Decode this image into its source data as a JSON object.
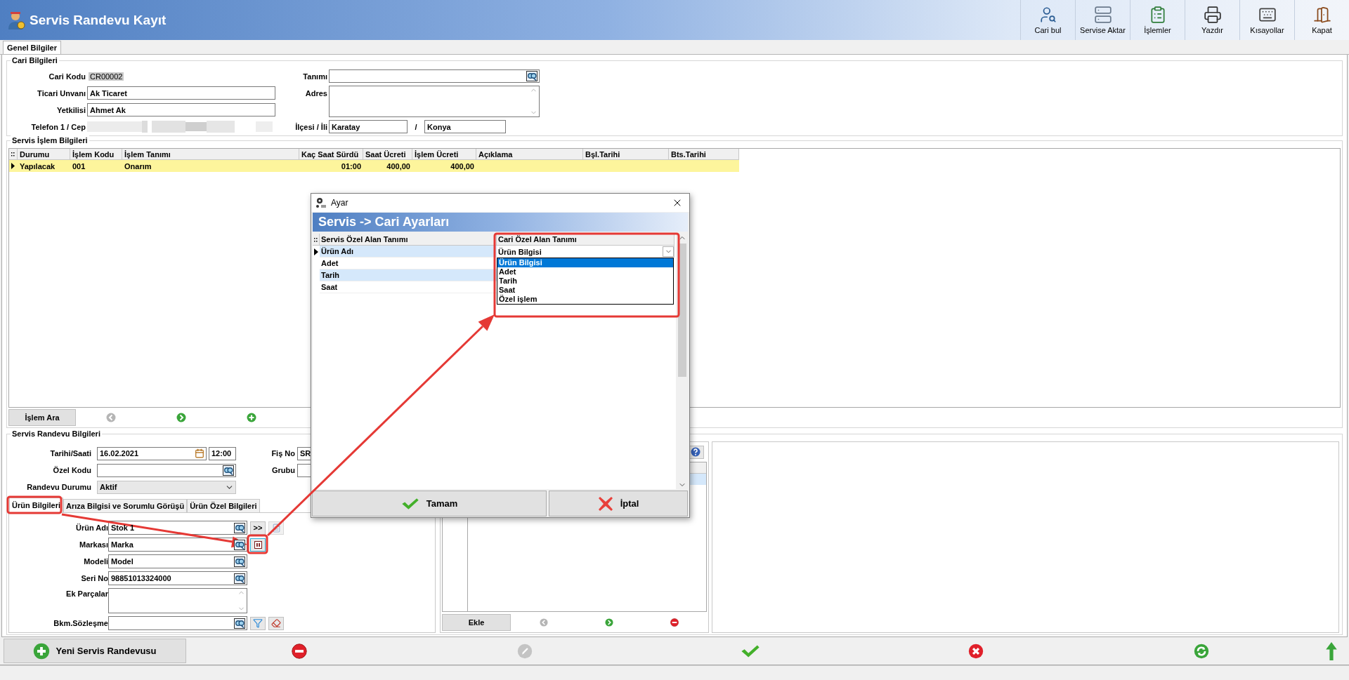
{
  "window": {
    "title": "Servis Randevu Kayıt"
  },
  "toolbar": [
    {
      "kind": "find",
      "label": "Cari bul"
    },
    {
      "kind": "transfer",
      "label": "Servise Aktar"
    },
    {
      "kind": "operations",
      "label": "İşlemler"
    },
    {
      "kind": "print",
      "label": "Yazdır"
    },
    {
      "kind": "shortcuts",
      "label": "Kısayollar"
    },
    {
      "kind": "close",
      "label": "Kapat"
    }
  ],
  "tabs": [
    {
      "label": "Genel Bilgiler",
      "selected": true
    }
  ],
  "cari": {
    "title": "Cari Bilgileri",
    "code": {
      "label": "Cari Kodu",
      "value": "CR00002"
    },
    "tanimi": {
      "label": "Tanımı"
    },
    "unvan": {
      "label": "Ticari Unvanı",
      "value": "Ak Ticaret"
    },
    "adres": {
      "label": "Adres"
    },
    "yetkili": {
      "label": "Yetkilisi",
      "value": "Ahmet Ak"
    },
    "telefon": {
      "label": "Telefon 1 / Cep"
    },
    "ilce_il": {
      "label": "İlçesi / İli",
      "ilce": "Karatay",
      "separator": "/",
      "il": "Konya"
    }
  },
  "islemler": {
    "title": "Servis İşlem Bilgileri",
    "columns": [
      "Durumu",
      "İşlem Kodu",
      "İşlem Tanımı",
      "Kaç Saat Sürdü",
      "Saat Ücreti",
      "İşlem Ücreti",
      "Açıklama",
      "Bşl.Tarihi",
      "Bts.Tarihi"
    ],
    "rows": [
      {
        "selected": true,
        "cells": [
          {
            "kind": "text",
            "text": "Yapılacak"
          },
          {
            "kind": "text",
            "text": "001"
          },
          {
            "kind": "text",
            "text": "Onarım"
          },
          {
            "kind": "number",
            "text": "01:00"
          },
          {
            "kind": "number",
            "text": "400,00"
          },
          {
            "kind": "number",
            "text": "400,00"
          }
        ]
      }
    ],
    "search_button": "İşlem Ara",
    "nav": [
      {
        "kind": "prev",
        "disabled": true
      },
      {
        "kind": "next",
        "disabled": false
      },
      {
        "kind": "add",
        "disabled": false
      }
    ]
  },
  "randevu": {
    "title": "Servis Randevu Bilgileri",
    "tarih": {
      "label": "Tarihi/Saati",
      "date": "16.02.2021",
      "time": "12:00"
    },
    "fis_no": {
      "label": "Fiş No",
      "value": "SR"
    },
    "ozel_kodu": {
      "label": "Özel Kodu"
    },
    "grubu": {
      "label": "Grubu"
    },
    "durum": {
      "label": "Randevu Durumu",
      "value": "Aktif"
    },
    "tabs": [
      {
        "label": "Ürün Bilgileri",
        "selected": true
      },
      {
        "label": "Arıza Bilgisi ve Sorumlu Görüşü",
        "selected": false
      },
      {
        "label": "Ürün Özel Bilgileri",
        "selected": false
      }
    ],
    "fields": [
      {
        "label": "Ürün Adı",
        "value": "Stok 1",
        "kind": "lookup",
        "actions": [
          {
            "kind": "text",
            "label": ">>"
          },
          {
            "kind": "form"
          }
        ]
      },
      {
        "label": "Markası",
        "value": "Marka",
        "kind": "lookup",
        "actions": [
          {
            "kind": "config"
          }
        ]
      },
      {
        "label": "Modeli",
        "value": "Model",
        "kind": "lookup"
      },
      {
        "label": "Seri No",
        "value": "98851013324000",
        "kind": "lookup"
      },
      {
        "label": "Ek Parçalar",
        "kind": "memo"
      },
      {
        "label": "Bkm.Sözleşme",
        "kind": "lookup",
        "actions": [
          {
            "kind": "filter"
          },
          {
            "kind": "eraser"
          }
        ]
      }
    ],
    "side_panel": {
      "add_button": "Ekle",
      "nav": [
        {
          "kind": "prev",
          "disabled": true
        },
        {
          "kind": "next",
          "disabled": false
        },
        {
          "kind": "remove",
          "disabled": false
        }
      ]
    }
  },
  "footer": {
    "new_button": "Yeni Servis Randevusu",
    "actions": [
      {
        "kind": "delete",
        "disabled": false
      },
      {
        "kind": "edit",
        "disabled": true
      },
      {
        "kind": "save",
        "disabled": false
      },
      {
        "kind": "cancel",
        "disabled": false
      },
      {
        "kind": "refresh",
        "disabled": false
      },
      {
        "kind": "up",
        "disabled": false
      }
    ]
  },
  "dialog": {
    "title": "Ayar",
    "heading": "Servis -> Cari Ayarları",
    "columns": [
      "Servis Özel Alan Tanımı",
      "Cari Özel Alan Tanımı"
    ],
    "rows": [
      {
        "name": "Ürün Adı",
        "selected": true
      },
      {
        "name": "Adet",
        "selected": false
      },
      {
        "name": "Tarih",
        "selected": false
      },
      {
        "name": "Saat",
        "selected": false
      }
    ],
    "combo": {
      "value": "Ürün Bilgisi",
      "expanded": true,
      "options": [
        {
          "label": "Ürün Bilgisi",
          "selected": true
        },
        {
          "label": "Adet",
          "selected": false
        },
        {
          "label": "Tarih",
          "selected": false
        },
        {
          "label": "Saat",
          "selected": false
        },
        {
          "label": "Özel işlem",
          "selected": false
        }
      ]
    },
    "ok_button": "Tamam",
    "cancel_button": "İptal"
  }
}
